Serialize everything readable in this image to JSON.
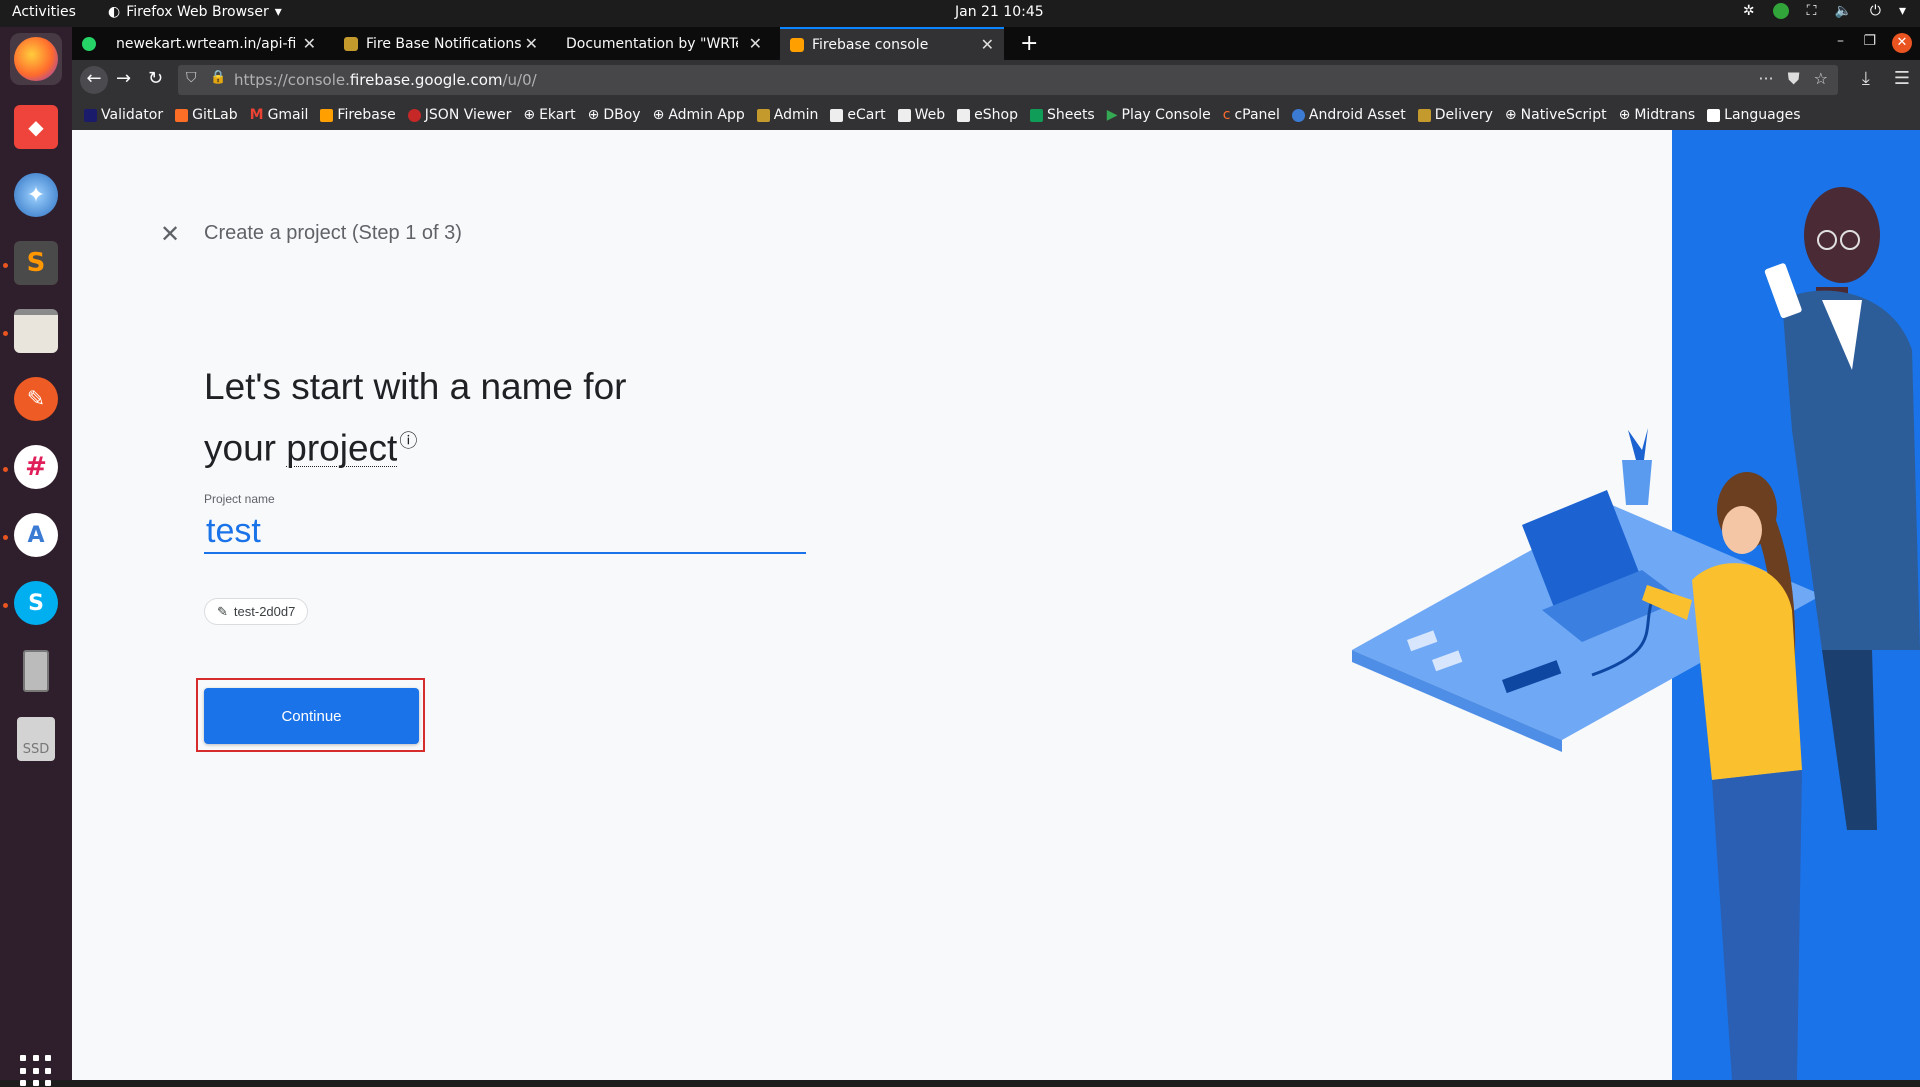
{
  "system": {
    "activities": "Activities",
    "app_menu": "Firefox Web Browser",
    "clock": "Jan 21  10:45"
  },
  "dock": {
    "items": [
      "firefox-icon",
      "anydesk-icon",
      "thunderbird-icon",
      "sublime-text-icon",
      "files-icon",
      "postman-icon",
      "slack-icon",
      "android-studio-icon",
      "skype-icon",
      "removable-drive-icon",
      "ssd-drive-icon"
    ],
    "ssd_label": "SSD"
  },
  "browser": {
    "tabs": [
      {
        "title": "newekart.wrteam.in/api-fire"
      },
      {
        "title": "Fire Base Notifications |"
      },
      {
        "title": "Documentation by \"WRTeam"
      },
      {
        "title": "Firebase console"
      }
    ],
    "url_prefix": "https://console.",
    "url_host": "firebase.google.com",
    "url_path": "/u/0/",
    "bookmarks": [
      "Validator",
      "GitLab",
      "Gmail",
      "Firebase",
      "JSON Viewer",
      "Ekart",
      "DBoy",
      "Admin App",
      "Admin",
      "eCart",
      "Web",
      "eShop",
      "Sheets",
      "Play Console",
      "cPanel",
      "Android Asset",
      "Delivery",
      "NativeScript",
      "Midtrans",
      "Languages"
    ]
  },
  "page": {
    "header_title": "Create a project (Step 1 of 3)",
    "headline_line1": "Let's start with a name for",
    "headline_line2_prefix": "your ",
    "headline_project_word": "project",
    "field_label": "Project name",
    "project_name_value": "test",
    "project_id": "test-2d0d7",
    "continue_label": "Continue"
  },
  "colors": {
    "accent": "#1a73e8",
    "illustration_bg": "#1a73e8",
    "highlight_border": "#d62c2c"
  }
}
